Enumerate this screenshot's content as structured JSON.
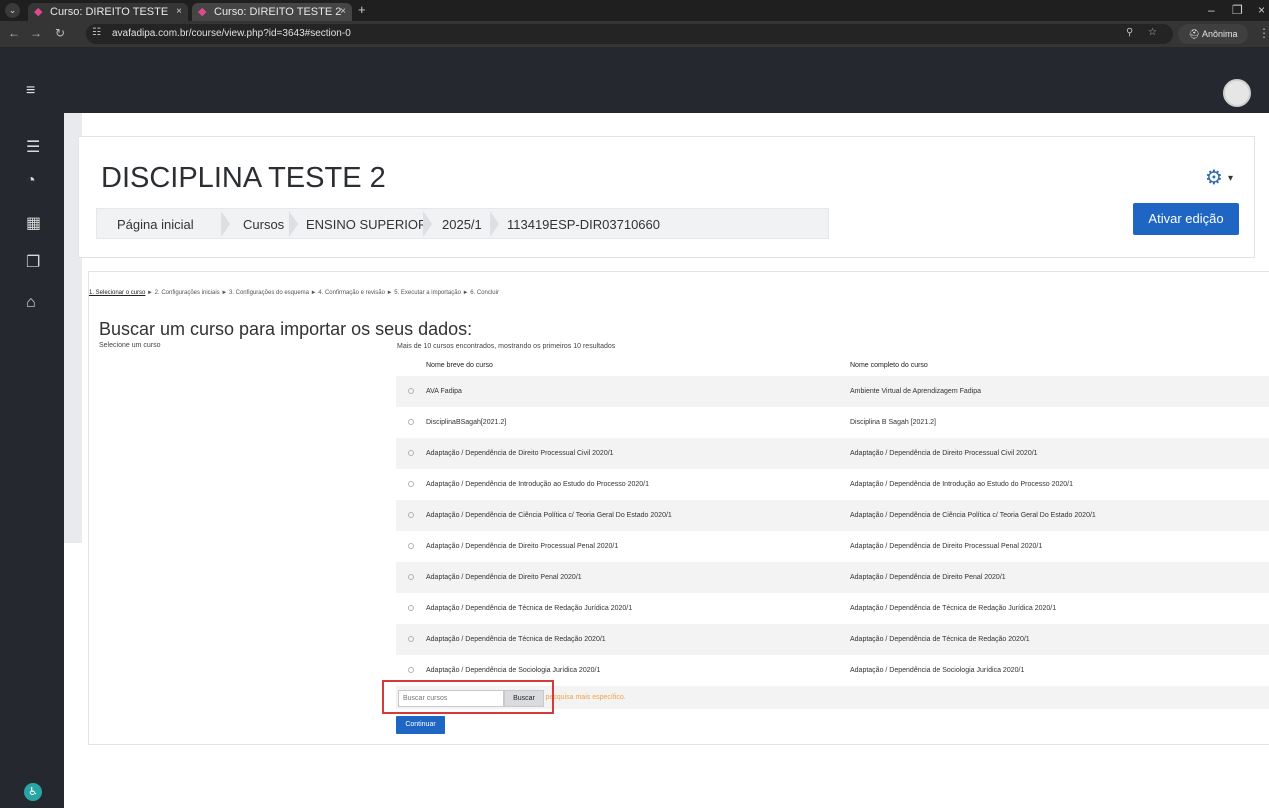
{
  "browser": {
    "tabs": [
      {
        "title": "Curso: DIREITO TESTE",
        "close": "×"
      },
      {
        "title": "Curso: DIREITO TESTE 2",
        "close": "×"
      }
    ],
    "new_tab": "+",
    "url": "avafadipa.com.br/course/view.php?id=3643#section-0",
    "profile_label": "Anônima"
  },
  "course": {
    "title": "DISCIPLINA TESTE 2",
    "breadcrumbs": [
      "Página inicial",
      "Cursos",
      "ENSINO SUPERIOR",
      "2025/1",
      "113419ESP-DIR03710660"
    ],
    "edit_button": "Ativar edição"
  },
  "import": {
    "steps": {
      "active": "1. Selecionar o curso",
      "rest": " ► 2. Configurações iniciais ► 3. Configurações do esquema ► 4. Confirmação e revisão ► 5. Executar a importação ► 6. Concluir"
    },
    "heading": "Buscar um curso para importar os seus dados:",
    "select_label": "Selecione um curso",
    "found_note": "Mais de 10 cursos encontrados, mostrando os primeiros 10 resultados",
    "columns": [
      "Nome breve do curso",
      "Nome completo do curso"
    ],
    "rows": [
      {
        "short": "AVA Fadipa",
        "full": "Ambiente Virtual de Aprendizagem Fadipa"
      },
      {
        "short": "DisciplinaBSagah[2021.2]",
        "full": "Disciplina B Sagah [2021.2]"
      },
      {
        "short": "Adaptação / Dependência de Direito Processual Civil 2020/1",
        "full": "Adaptação / Dependência de Direito Processual Civil 2020/1"
      },
      {
        "short": "Adaptação / Dependência de Introdução ao Estudo do Processo 2020/1",
        "full": "Adaptação / Dependência de Introdução ao Estudo do Processo 2020/1"
      },
      {
        "short": "Adaptação / Dependência de Ciência Política c/ Teoria Geral Do Estado 2020/1",
        "full": "Adaptação / Dependência de Ciência Política c/ Teoria Geral Do Estado 2020/1"
      },
      {
        "short": "Adaptação / Dependência de Direito Processual Penal 2020/1",
        "full": "Adaptação / Dependência de Direito Processual Penal 2020/1"
      },
      {
        "short": "Adaptação / Dependência de Direito Penal 2020/1",
        "full": "Adaptação / Dependência de Direito Penal 2020/1"
      },
      {
        "short": "Adaptação / Dependência de Técnica de Redação Jurídica 2020/1",
        "full": "Adaptação / Dependência de Técnica de Redação Jurídica 2020/1"
      },
      {
        "short": "Adaptação / Dependência de Técnica de Redação 2020/1",
        "full": "Adaptação / Dependência de Técnica de Redação 2020/1"
      },
      {
        "short": "Adaptação / Dependência de Sociologia Jurídica 2020/1",
        "full": "Adaptação / Dependência de Sociologia Jurídica 2020/1"
      }
    ],
    "warning": "Existem muitos resultados, digite um termo de pesquisa mais específico.",
    "search_placeholder": "Buscar cursos",
    "search_button": "Buscar",
    "continue_button": "Continuar"
  },
  "colors": {
    "primary": "#1f66c4",
    "navbar": "#25282f",
    "highlight": "#d43a3a",
    "warning": "#f0a34a"
  }
}
